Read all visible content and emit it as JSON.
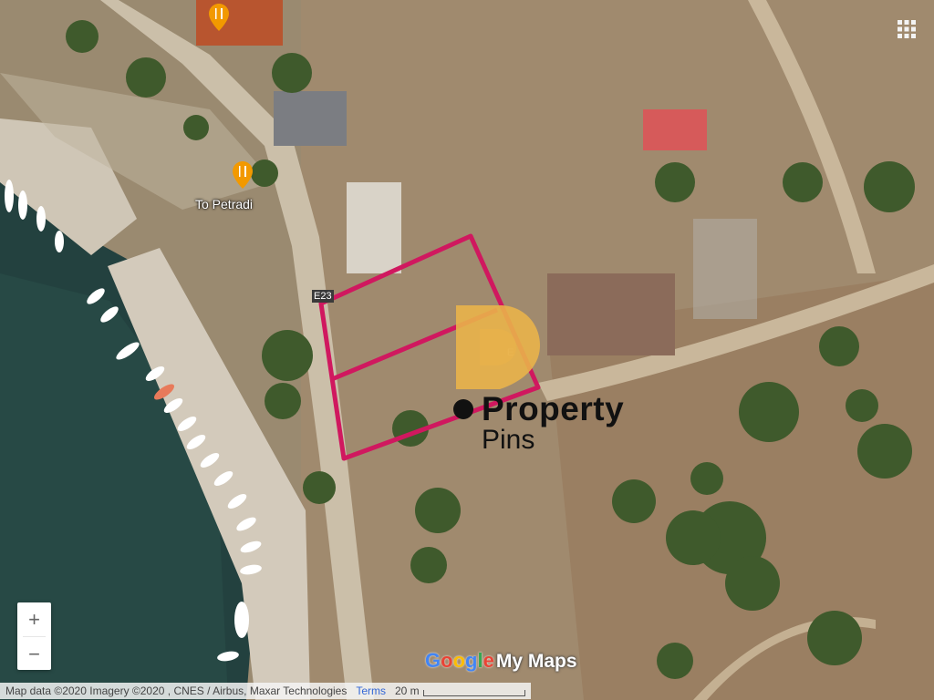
{
  "map": {
    "poi": {
      "restaurant_label": "To Petradi",
      "restaurant_icon": "restaurant-fork-knife-icon",
      "pin_color": "#f29900"
    },
    "road_labels": {
      "primary": "E23",
      "secondary": "E"
    },
    "parcel_outline_color": "#d0185f"
  },
  "logo": {
    "word1": "Property",
    "word2": "Pins",
    "accent_color": "#e9b24a"
  },
  "controls": {
    "zoom_in": "+",
    "zoom_out": "−",
    "layers_icon": "grid-dots-icon"
  },
  "branding": {
    "google": [
      "G",
      "o",
      "o",
      "g",
      "l",
      "e"
    ],
    "google_colors": [
      "#4285f4",
      "#ea4335",
      "#fbbc05",
      "#4285f4",
      "#34a853",
      "#ea4335"
    ],
    "my_maps": "My Maps"
  },
  "attribution": {
    "text": "Map data ©2020 Imagery ©2020 , CNES / Airbus, Maxar Technologies",
    "terms": "Terms",
    "scale": "20 m"
  }
}
